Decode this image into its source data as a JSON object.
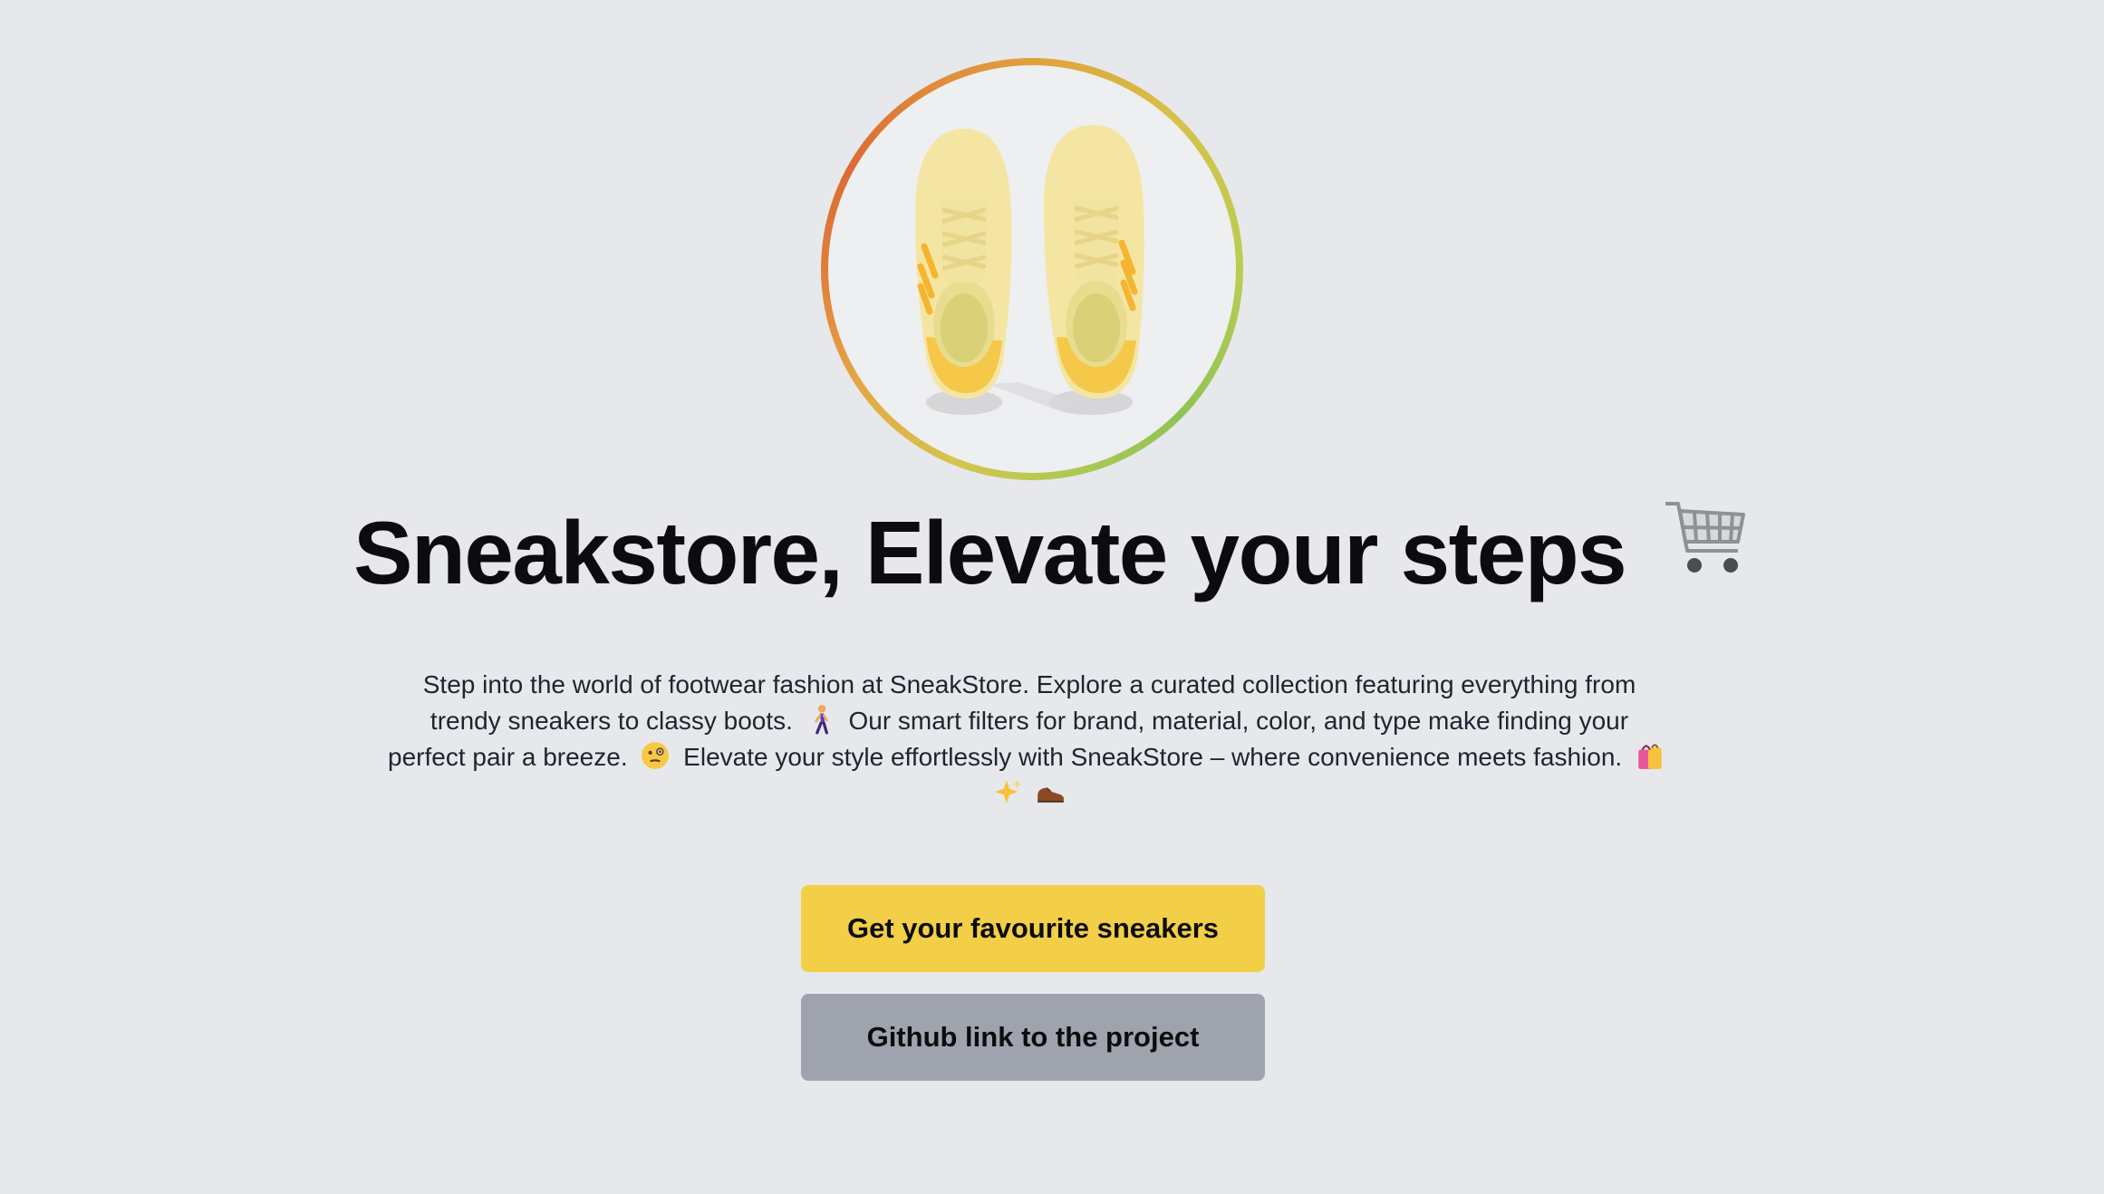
{
  "hero": {
    "image_alt": "yellow sneakers",
    "headline": "Sneakstore, Elevate your steps",
    "headline_icon": "shopping-cart-icon",
    "description": {
      "line1": "Step into the world of footwear fashion at SneakStore. Explore a curated collection featuring everything from",
      "line2_a": "trendy sneakers to classy boots.",
      "line2_b": "Our smart filters for brand, material, color, and type make finding your",
      "line3_a": "perfect pair a breeze.",
      "line3_b": "Elevate your style effortlessly with SneakStore – where convenience meets fashion.",
      "icons": [
        "person-walking-icon",
        "thinking-face-icon",
        "shopping-bags-icon",
        "sparkles-icon",
        "shoe-icon"
      ]
    },
    "primary_button": "Get your favourite sneakers",
    "secondary_button": "Github link to the project"
  },
  "colors": {
    "background": "#e7e8eb",
    "primary_button": "#f3cf48",
    "secondary_button": "#9fa3ae",
    "text": "#0c0c0e"
  }
}
